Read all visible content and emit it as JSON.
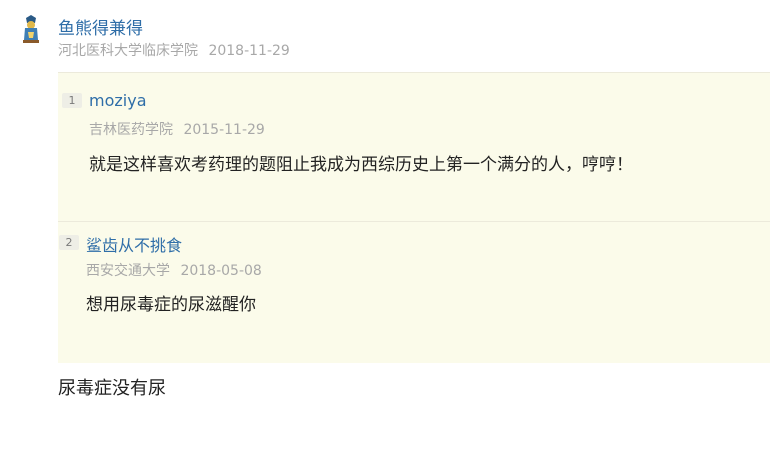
{
  "comment": {
    "author": {
      "name": "鱼熊得兼得",
      "school": "河北医科大学临床学院",
      "date": "2018-11-29",
      "avatar_icon": "dragon-mascot-icon"
    },
    "quotes": [
      {
        "floor": "1",
        "name": "moziya",
        "school": "吉林医药学院",
        "date": "2015-11-29",
        "text": "就是这样喜欢考药理的题阻止我成为西综历史上第一个满分的人，哼哼！"
      },
      {
        "floor": "2",
        "name": "鲨齿从不挑食",
        "school": "西安交通大学",
        "date": "2018-05-08",
        "text": "想用尿毒症的尿滋醒你"
      }
    ],
    "reply_text": "尿毒症没有尿"
  },
  "colors": {
    "link": "#2f6ea8",
    "meta": "#a8a8a8",
    "quote_bg": "#fbfbea"
  }
}
